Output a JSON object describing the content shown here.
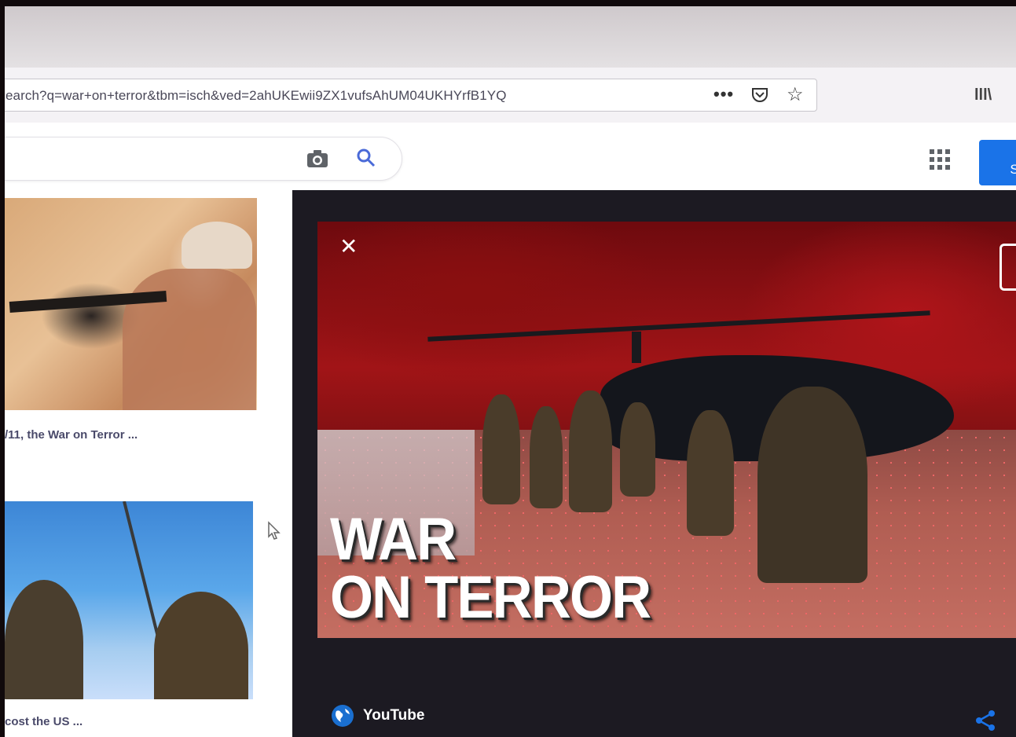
{
  "browser": {
    "url": "earch?q=war+on+terror&tbm=isch&ved=2ahUKEwii9ZX1vufsAhUM04UKHYrfB1YQ",
    "menu_dots": "•••",
    "star": "☆",
    "library": "lll\\"
  },
  "header": {
    "signin_label": "S"
  },
  "results": [
    {
      "caption": "/11, the War on Terror ..."
    },
    {
      "caption": "cost the US ..."
    }
  ],
  "preview": {
    "close": "✕",
    "headline_line1": "WAR",
    "headline_line2": "ON TERROR",
    "source": "YouTube"
  },
  "colors": {
    "accent_blue": "#1a73e8",
    "preview_bg": "#1c1a22",
    "headline_red": "#a11417"
  },
  "icons": [
    "camera-icon",
    "search-icon",
    "apps-icon",
    "pocket-icon",
    "star-icon",
    "library-icon",
    "close-icon",
    "youtube-icon",
    "share-icon",
    "cursor-icon"
  ]
}
